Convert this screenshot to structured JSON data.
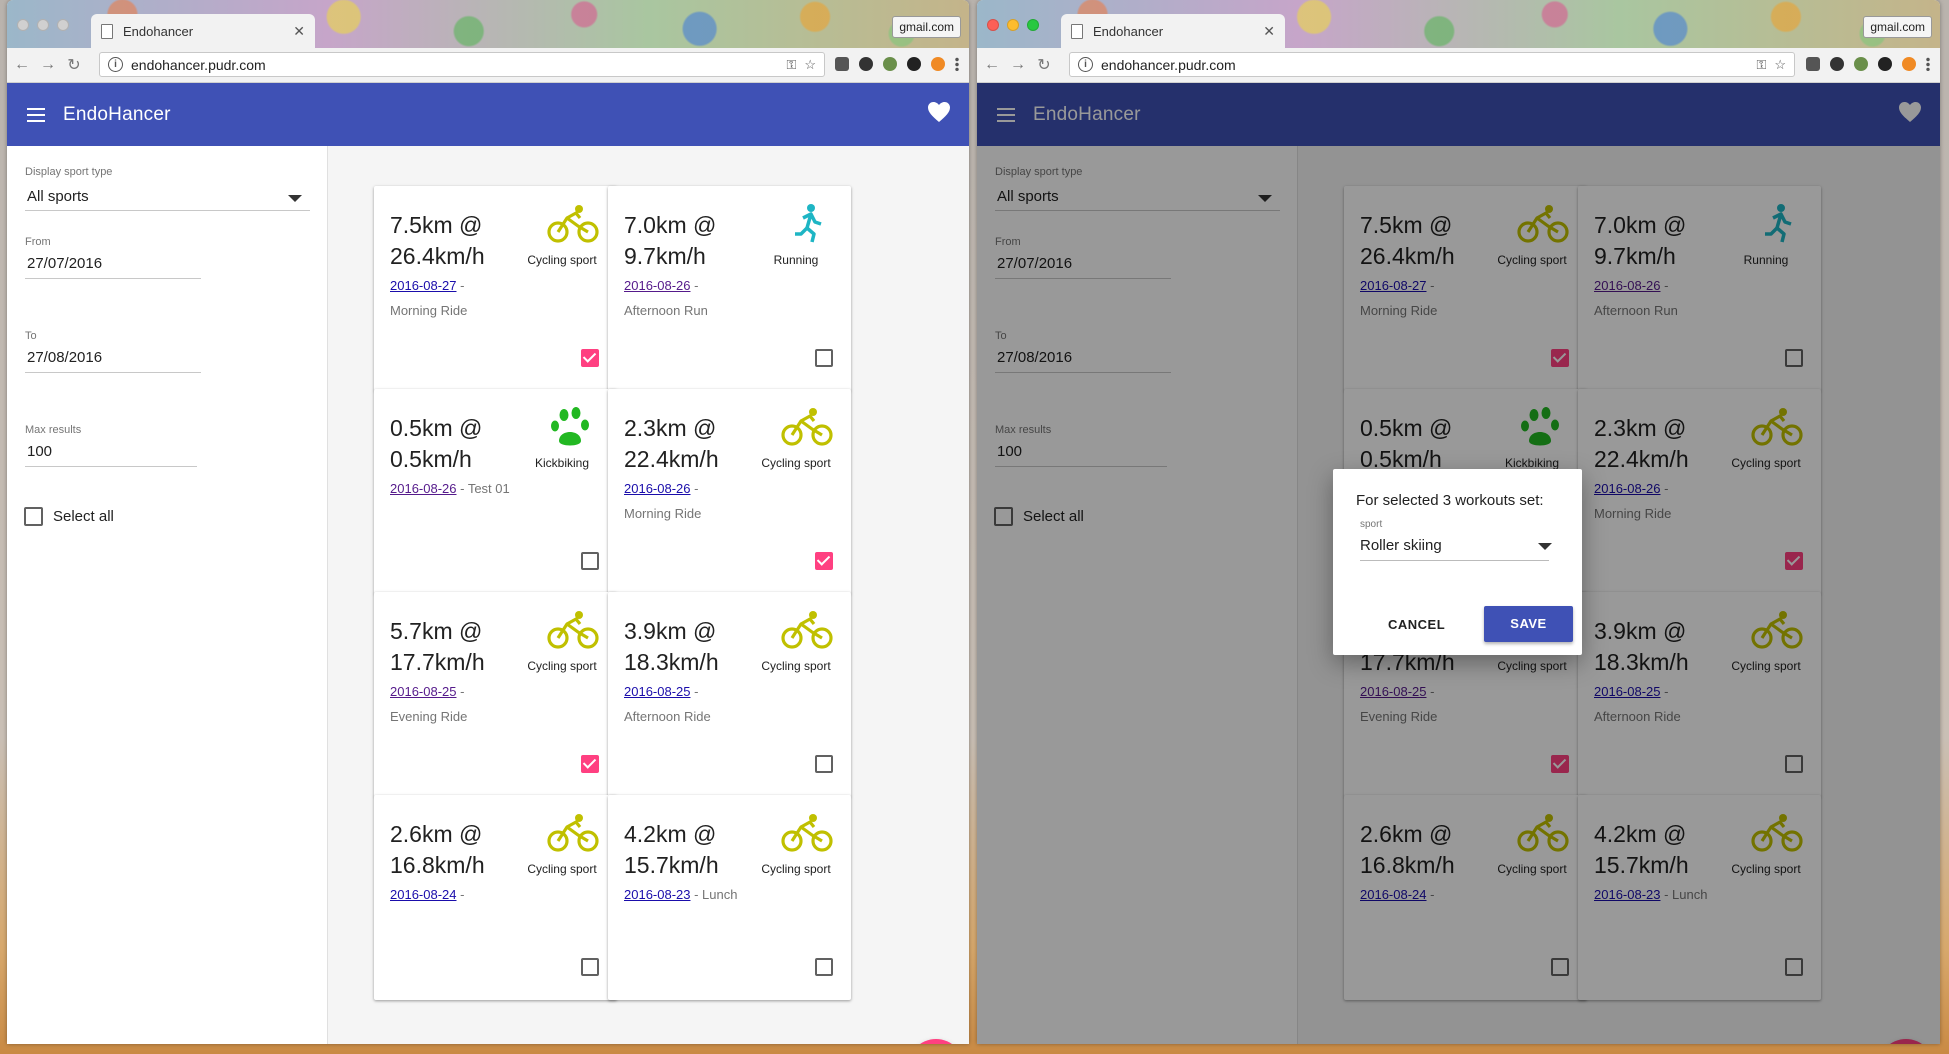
{
  "browser": {
    "tab_title": "Endohancer",
    "profile": "gmail.com",
    "url": "endohancer.pudr.com"
  },
  "app": {
    "title": "EndoHancer"
  },
  "filters": {
    "sport_label": "Display sport type",
    "sport_value": "All sports",
    "from_label": "From",
    "from_value": "27/07/2016",
    "to_label": "To",
    "to_value": "27/08/2016",
    "max_label": "Max results",
    "max_value": "100",
    "select_all_label": "Select all"
  },
  "workouts": [
    {
      "distance": "7.5km @",
      "speed": "26.4km/h",
      "date": "2016-08-27",
      "sep": " -",
      "name": "Morning Ride",
      "sport": "Cycling sport",
      "icon": "bicycle-icon",
      "checked": true,
      "visited": false
    },
    {
      "distance": "7.0km @",
      "speed": "9.7km/h",
      "date": "2016-08-26",
      "sep": " -",
      "name": "Afternoon Run",
      "sport": "Running",
      "icon": "running-icon",
      "checked": false,
      "visited": true
    },
    {
      "distance": "0.5km @",
      "speed": "0.5km/h",
      "date": "2016-08-26",
      "sep": " - Test 01",
      "name": "",
      "sport": "Kickbiking",
      "icon": "paw-icon",
      "checked": false,
      "visited": true
    },
    {
      "distance": "2.3km @",
      "speed": "22.4km/h",
      "date": "2016-08-26",
      "sep": " -",
      "name": "Morning Ride",
      "sport": "Cycling sport",
      "icon": "bicycle-icon",
      "checked": true,
      "visited": false
    },
    {
      "distance": "5.7km @",
      "speed": "17.7km/h",
      "date": "2016-08-25",
      "sep": " -",
      "name": "Evening Ride",
      "sport": "Cycling sport",
      "icon": "bicycle-icon",
      "checked": true,
      "visited": true
    },
    {
      "distance": "3.9km @",
      "speed": "18.3km/h",
      "date": "2016-08-25",
      "sep": " -",
      "name": "Afternoon Ride",
      "sport": "Cycling sport",
      "icon": "bicycle-icon",
      "checked": false,
      "visited": false
    },
    {
      "distance": "2.6km @",
      "speed": "16.8km/h",
      "date": "2016-08-24",
      "sep": " -",
      "name": "",
      "sport": "Cycling sport",
      "icon": "bicycle-icon",
      "checked": false,
      "visited": false
    },
    {
      "distance": "4.2km @",
      "speed": "15.7km/h",
      "date": "2016-08-23",
      "sep": " - Lunch",
      "name": "",
      "sport": "Cycling sport",
      "icon": "bicycle-icon",
      "checked": false,
      "visited": false
    }
  ],
  "fab_count": "3",
  "dialog": {
    "title": "For selected 3 workouts set:",
    "field_label": "sport",
    "field_value": "Roller skiing",
    "cancel": "CANCEL",
    "save": "SAVE"
  },
  "colors": {
    "primary": "#3f51b5",
    "accent": "#ff4081",
    "cycling": "#c0c000",
    "running": "#1eb5c4",
    "kickbiking": "#22b822"
  }
}
